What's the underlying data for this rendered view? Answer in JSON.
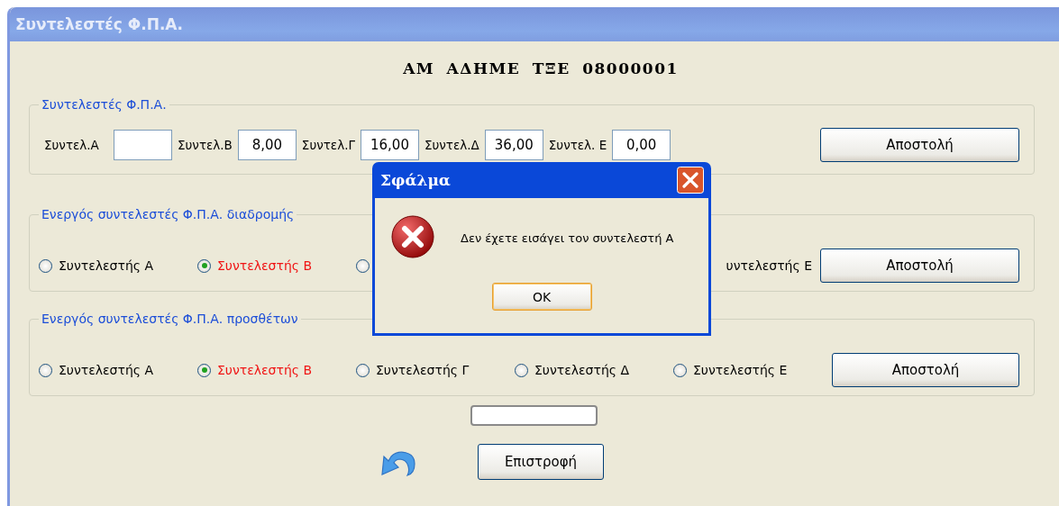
{
  "window": {
    "title": "Συντελεστές Φ.Π.Α."
  },
  "header": "ΑΜ ΑΔΗΜΕ ΤΞΕ 08000001",
  "rates_group": {
    "legend": "Συντελεστές Φ.Π.Α.",
    "button": "Αποστολή",
    "fields": [
      {
        "label": "Συντελ.Α"
      },
      {
        "label": "Συντελ.Β",
        "value": "8,00"
      },
      {
        "label": "Συντελ.Γ",
        "value": "16,00"
      },
      {
        "label": "Συντελ.Δ",
        "value": "36,00"
      },
      {
        "label": "Συντελ. Ε",
        "value": "0,00"
      }
    ]
  },
  "route_group": {
    "legend": "Ενεργός συντελεστές Φ.Π.Α. διαδρομής",
    "button": "Αποστολή",
    "options": [
      {
        "kind": "radio",
        "label": "Συντελεστής Α",
        "selected": false
      },
      {
        "kind": "radio",
        "label": "Συντελεστής Β",
        "selected": true
      },
      {
        "kind": "radio_only",
        "selected": false
      },
      {
        "kind": "covered"
      },
      {
        "kind": "label_only",
        "label": "υντελεστής Ε"
      }
    ]
  },
  "extras_group": {
    "legend": "Ενεργός συντελεστές Φ.Π.Α. προσθέτων",
    "button": "Αποστολή",
    "options": [
      {
        "kind": "radio",
        "label": "Συντελεστής Α",
        "selected": false
      },
      {
        "kind": "radio",
        "label": "Συντελεστής Β",
        "selected": true
      },
      {
        "kind": "radio",
        "label": "Συντελεστής Γ",
        "selected": false
      },
      {
        "kind": "radio",
        "label": "Συντελεστής Δ",
        "selected": false
      },
      {
        "kind": "radio",
        "label": "Συντελεστής Ε",
        "selected": false
      }
    ]
  },
  "back_button": "Επιστροφή",
  "dialog": {
    "title": "Σφάλμα",
    "message": "Δεν έχετε εισάγει τον συντελεστή Α",
    "ok": "OK"
  }
}
